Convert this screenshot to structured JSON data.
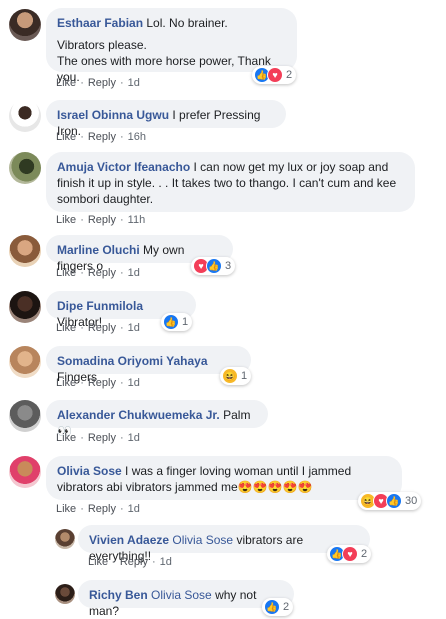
{
  "actions": {
    "like": "Like",
    "reply": "Reply",
    "sep": "·"
  },
  "comments": [
    {
      "author": "Esthaar Fabian",
      "lines": [
        "Lol. No brainer.",
        "Vibrators please.",
        "The ones with more horse power, Thank you."
      ],
      "time": "1d",
      "reactions": [
        "like",
        "love"
      ],
      "count": "2"
    },
    {
      "author": "Israel Obinna Ugwu",
      "text": "I prefer Pressing Iron.",
      "time": "16h"
    },
    {
      "author": "Amuja Victor Ifeanacho",
      "text": "I can now get my lux or joy soap and finish it up in style. . . It takes two to thango. I can't cum and kee sombori daughter.",
      "time": "11h"
    },
    {
      "author": "Marline Oluchi",
      "text": "My own fingers o",
      "time": "1d",
      "reactions": [
        "love",
        "like"
      ],
      "count": "3"
    },
    {
      "author": "Dipe Funmilola",
      "text": "Vibrator!",
      "time": "1d",
      "reactions": [
        "like"
      ],
      "count": "1"
    },
    {
      "author": "Somadina Oriyomi Yahaya",
      "text": "Fingers",
      "time": "1d",
      "reactions": [
        "haha"
      ],
      "count": "1"
    },
    {
      "author": "Alexander Chukwuemeka Jr.",
      "text": "Palm 👀",
      "time": "1d"
    },
    {
      "author": "Olivia Sose",
      "text": "I was a finger loving woman until I jammed vibrators abi vibrators jammed me😍😍😍😍😍",
      "time": "1d",
      "reactions": [
        "haha",
        "love",
        "like"
      ],
      "count": "30"
    }
  ],
  "replies": [
    {
      "author": "Vivien Adaeze",
      "mention": "Olivia Sose",
      "text": "vibrators are everything!!",
      "time": "1d",
      "reactions": [
        "like",
        "love"
      ],
      "count": "2"
    },
    {
      "author": "Richy Ben",
      "mention": "Olivia Sose",
      "text": "why not man?",
      "count": "2"
    }
  ]
}
